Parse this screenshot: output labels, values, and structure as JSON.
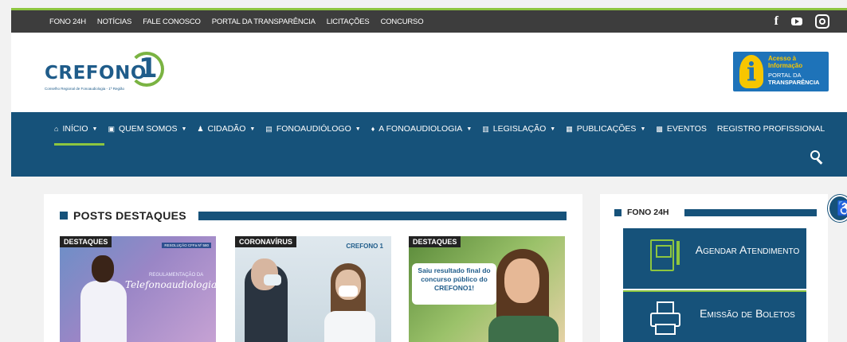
{
  "topbar": {
    "links": [
      "FONO 24H",
      "NOTÍCIAS",
      "FALE CONOSCO",
      "PORTAL DA TRANSPARÊNCIA",
      "LICITAÇÕES",
      "CONCURSO"
    ],
    "social": {
      "facebook": "f"
    }
  },
  "header": {
    "logo_word": "CREFONO",
    "logo_digit": "1",
    "logo_subtitle": "Conselho Regional de Fonoaudiologia - 1ª Região",
    "transparency": {
      "line1": "Acesso à Informação",
      "line2a": "PORTAL DA",
      "line2b": "TRANSPARÊNCIA"
    }
  },
  "nav": {
    "items": [
      {
        "label": "INÍCIO",
        "icon": "home-icon",
        "glyph": "⌂",
        "caret": true
      },
      {
        "label": "QUEM SOMOS",
        "icon": "id-card-icon",
        "glyph": "▣",
        "caret": true
      },
      {
        "label": "CIDADÃO",
        "icon": "person-icon",
        "glyph": "♟",
        "caret": true
      },
      {
        "label": "FONOAUDIÓLOGO",
        "icon": "badge-icon",
        "glyph": "▤",
        "caret": true
      },
      {
        "label": "A FONOAUDIOLOGIA",
        "icon": "microphone-icon",
        "glyph": "♦",
        "caret": true
      },
      {
        "label": "LEGISLAÇÃO",
        "icon": "building-icon",
        "glyph": "▥",
        "caret": true
      },
      {
        "label": "PUBLICAÇÕES",
        "icon": "newspaper-icon",
        "glyph": "▦",
        "caret": true
      },
      {
        "label": "EVENTOS",
        "icon": "calendar-icon",
        "glyph": "▩",
        "caret": false
      },
      {
        "label": "REGISTRO PROFISSIONAL",
        "icon": "",
        "glyph": "",
        "caret": false
      }
    ],
    "caret_glyph": "▼"
  },
  "main": {
    "title": "POSTS DESTAQUES",
    "posts": [
      {
        "tag": "DESTAQUES",
        "badge": "RESOLUÇÃO CFFa Nº 580",
        "line1": "REGULAMENTAÇÃO DA",
        "line2": "Telefonoaudiologia"
      },
      {
        "tag": "CORONAVÍRUS",
        "brand": "CREFONO 1"
      },
      {
        "tag": "DESTAQUES",
        "bubble": "Saiu resultado final do concurso público do CREFONO1!"
      }
    ]
  },
  "side": {
    "title": "FONO 24H",
    "services": [
      {
        "label": "Agendar Atendimento",
        "icon": "book-icon"
      },
      {
        "label": "Emissão de Boletos",
        "icon": "printer-icon"
      }
    ]
  },
  "accessibility": {
    "glyph": "♿",
    "icon": "accessibility-icon"
  }
}
